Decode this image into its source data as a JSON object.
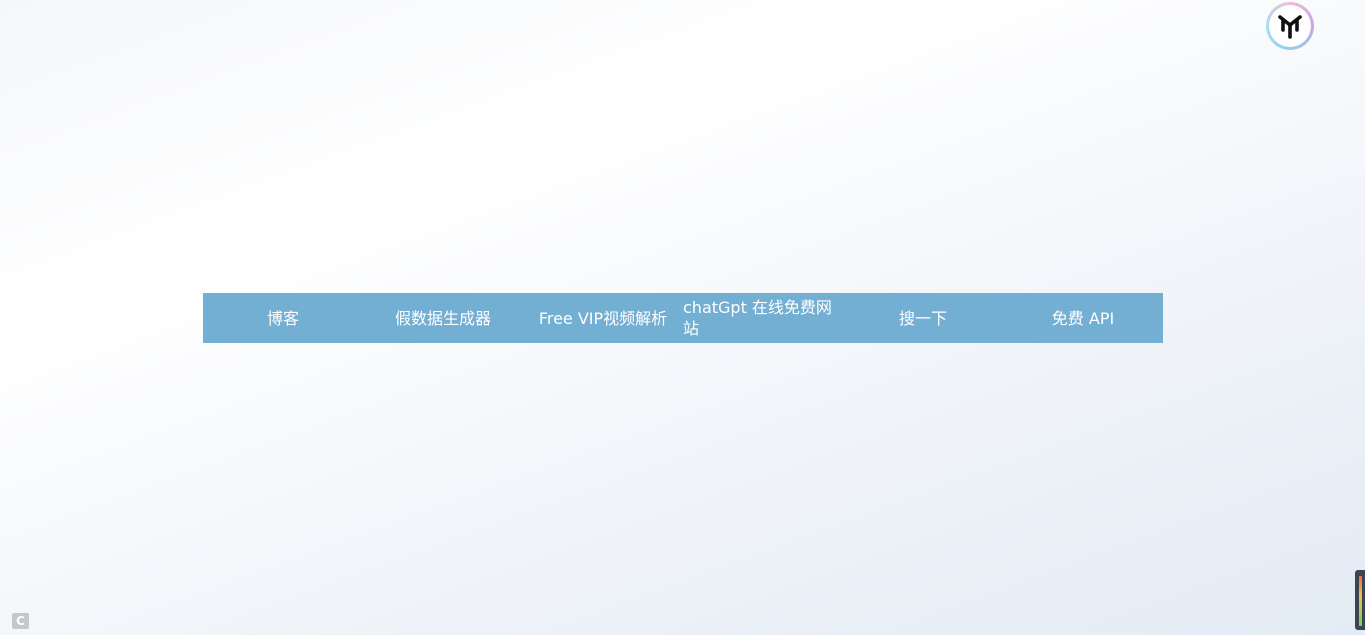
{
  "logo": {
    "icon": "y-logo-icon"
  },
  "nav": {
    "items": [
      {
        "label": "博客"
      },
      {
        "label": "假数据生成器"
      },
      {
        "label": "Free VIP视频解析"
      },
      {
        "label": "chatGpt 在线免费网站"
      },
      {
        "label": "搜一下"
      },
      {
        "label": "免费 API"
      }
    ]
  },
  "corner": {
    "glyph": "C",
    "icon": "c-badge-icon"
  },
  "colors": {
    "nav_background": "#73afd2",
    "nav_text": "#ffffff"
  }
}
